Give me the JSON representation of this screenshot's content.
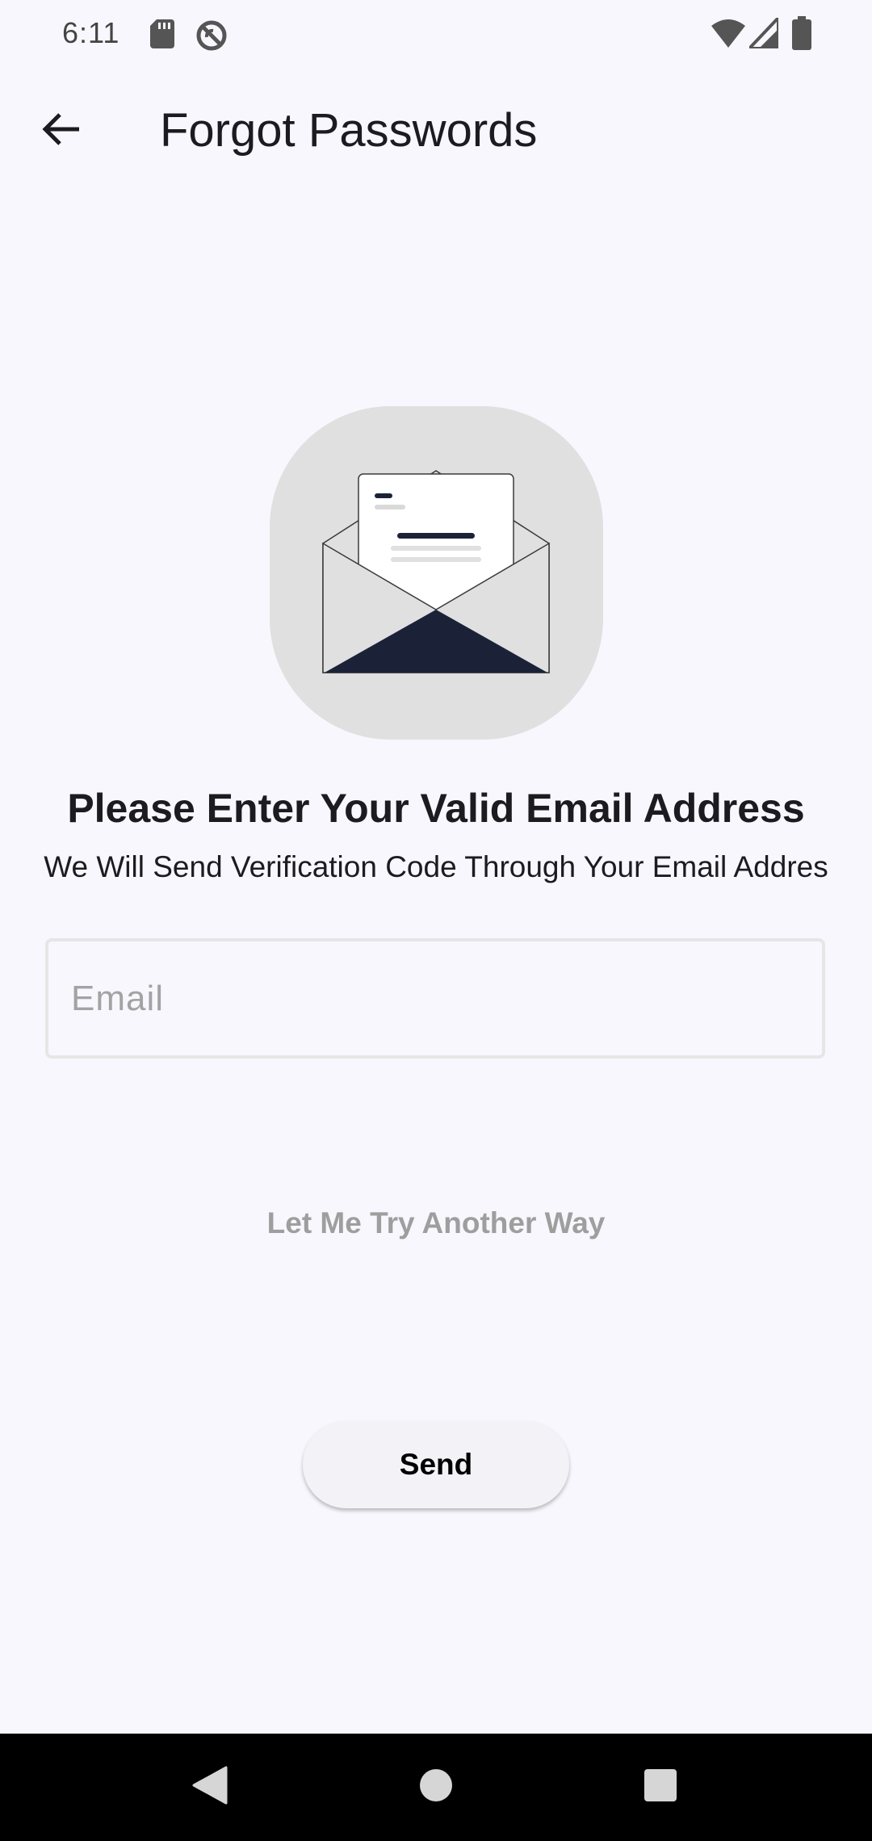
{
  "status_bar": {
    "time": "6:11",
    "icons": [
      "sd-card-icon",
      "no-sync-icon",
      "wifi-icon",
      "cell-signal-icon",
      "battery-icon"
    ]
  },
  "app_bar": {
    "back_icon": "arrow-back-icon",
    "title": "Forgot Passwords"
  },
  "illustration": {
    "icon": "open-envelope-icon",
    "colors": {
      "background": "#e0e0e0",
      "accent": "#1b2238"
    }
  },
  "content": {
    "headline": "Please Enter Your Valid Email Address",
    "subline": "We Will Send Verification Code Through Your Email Addres"
  },
  "email_input": {
    "placeholder": "Email",
    "value": ""
  },
  "alt_link": "Let Me Try Another Way",
  "send_button": {
    "label": "Send"
  },
  "nav_bar": {
    "icons": [
      "nav-back-icon",
      "nav-home-icon",
      "nav-recents-icon"
    ]
  },
  "colors": {
    "background": "#f8f7fd",
    "text": "#1c1b1f",
    "muted_text": "#9e9e9e"
  }
}
